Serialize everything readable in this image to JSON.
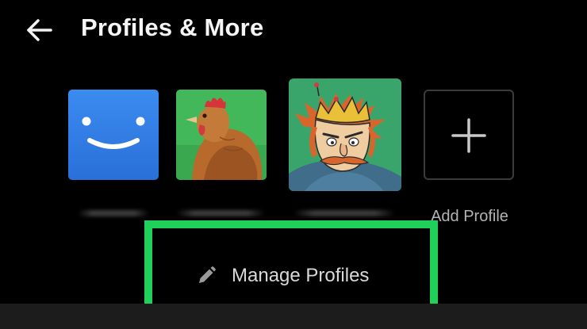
{
  "header": {
    "title": "Profiles & More",
    "back_icon": "arrow-left-icon"
  },
  "profiles": [
    {
      "avatar": "blue-smiley",
      "name_hidden": true
    },
    {
      "avatar": "chicken",
      "name_hidden": true
    },
    {
      "avatar": "cartoon-king",
      "name_hidden": true,
      "selected": true
    }
  ],
  "add_profile": {
    "label": "Add Profile",
    "icon": "plus-icon"
  },
  "manage_profiles": {
    "label": "Manage Profiles",
    "icon": "pencil-icon",
    "highlight_color": "#1fd15a"
  },
  "colors": {
    "background": "#000000",
    "title": "#f5f5f5",
    "muted_text": "#b3b3b3",
    "smiley_blue": "#2f7ee0"
  }
}
